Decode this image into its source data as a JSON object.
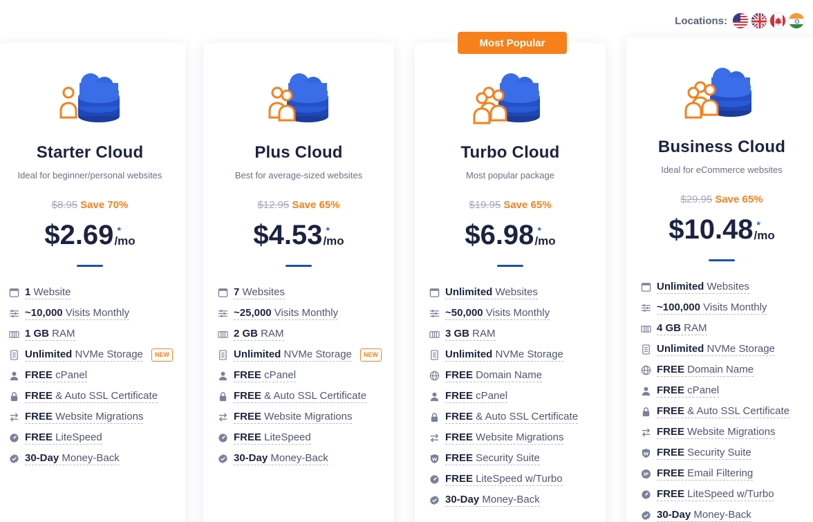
{
  "locations": {
    "label": "Locations:",
    "flags": [
      "us-flag-icon",
      "uk-flag-icon",
      "canada-flag-icon",
      "india-flag-icon"
    ]
  },
  "badge": "Most Popular",
  "colors": {
    "accent": "#f7801b",
    "brand": "#1c4fb8",
    "text": "#1c2340"
  },
  "plans": [
    {
      "name": "Starter Cloud",
      "desc": "Ideal for beginner/personal websites",
      "old_price": "$8.95",
      "save": "Save 70%",
      "price": "$2.69",
      "star": "*",
      "per": "/mo",
      "features": [
        {
          "icon": "window-icon",
          "bold": "1",
          "text": " Website"
        },
        {
          "icon": "sliders-icon",
          "bold": "~10,000",
          "text": " Visits Monthly"
        },
        {
          "icon": "ram-icon",
          "bold": "1 GB",
          "text": " RAM"
        },
        {
          "icon": "storage-icon",
          "bold": "Unlimited",
          "text": " NVMe Storage",
          "tag": "NEW"
        },
        {
          "icon": "user-icon",
          "bold": "FREE",
          "text": " cPanel"
        },
        {
          "icon": "lock-icon",
          "bold": "FREE",
          "text": " & Auto SSL Certificate"
        },
        {
          "icon": "arrows-icon",
          "bold": "FREE",
          "text": " Website Migrations"
        },
        {
          "icon": "speed-icon",
          "bold": "FREE",
          "text": " LiteSpeed"
        },
        {
          "icon": "badge-check-icon",
          "bold": "30-Day",
          "text": " Money-Back"
        }
      ]
    },
    {
      "name": "Plus Cloud",
      "desc": "Best for average-sized websites",
      "old_price": "$12.95",
      "save": "Save 65%",
      "price": "$4.53",
      "star": "*",
      "per": "/mo",
      "features": [
        {
          "icon": "window-icon",
          "bold": "7",
          "text": " Websites"
        },
        {
          "icon": "sliders-icon",
          "bold": "~25,000",
          "text": " Visits Monthly"
        },
        {
          "icon": "ram-icon",
          "bold": "2 GB",
          "text": " RAM"
        },
        {
          "icon": "storage-icon",
          "bold": "Unlimited",
          "text": " NVMe Storage",
          "tag": "NEW"
        },
        {
          "icon": "user-icon",
          "bold": "FREE",
          "text": " cPanel"
        },
        {
          "icon": "lock-icon",
          "bold": "FREE",
          "text": " & Auto SSL Certificate"
        },
        {
          "icon": "arrows-icon",
          "bold": "FREE",
          "text": " Website Migrations"
        },
        {
          "icon": "speed-icon",
          "bold": "FREE",
          "text": " LiteSpeed"
        },
        {
          "icon": "badge-check-icon",
          "bold": "30-Day",
          "text": " Money-Back"
        }
      ]
    },
    {
      "name": "Turbo Cloud",
      "desc": "Most popular package",
      "old_price": "$19.95",
      "save": "Save 65%",
      "price": "$6.98",
      "star": "*",
      "per": "/mo",
      "features": [
        {
          "icon": "window-icon",
          "bold": "Unlimited",
          "text": " Websites"
        },
        {
          "icon": "sliders-icon",
          "bold": "~50,000",
          "text": " Visits Monthly"
        },
        {
          "icon": "ram-icon",
          "bold": "3 GB",
          "text": " RAM"
        },
        {
          "icon": "storage-icon",
          "bold": "Unlimited",
          "text": " NVMe Storage"
        },
        {
          "icon": "globe-icon",
          "bold": "FREE",
          "text": " Domain Name"
        },
        {
          "icon": "user-icon",
          "bold": "FREE",
          "text": " cPanel"
        },
        {
          "icon": "lock-icon",
          "bold": "FREE",
          "text": " & Auto SSL Certificate"
        },
        {
          "icon": "arrows-icon",
          "bold": "FREE",
          "text": " Website Migrations"
        },
        {
          "icon": "shield-icon",
          "bold": "FREE",
          "text": " Security Suite"
        },
        {
          "icon": "speed-icon",
          "bold": "FREE",
          "text": " LiteSpeed w/Turbo"
        },
        {
          "icon": "badge-check-icon",
          "bold": "30-Day",
          "text": " Money-Back"
        }
      ]
    },
    {
      "name": "Business Cloud",
      "desc": "Ideal for eCommerce websites",
      "old_price": "$29.95",
      "save": "Save 65%",
      "price": "$10.48",
      "star": "*",
      "per": "/mo",
      "features": [
        {
          "icon": "window-icon",
          "bold": "Unlimited",
          "text": " Websites"
        },
        {
          "icon": "sliders-icon",
          "bold": "~100,000",
          "text": " Visits Monthly"
        },
        {
          "icon": "ram-icon",
          "bold": "4 GB",
          "text": " RAM"
        },
        {
          "icon": "storage-icon",
          "bold": "Unlimited",
          "text": " NVMe Storage"
        },
        {
          "icon": "globe-icon",
          "bold": "FREE",
          "text": " Domain Name"
        },
        {
          "icon": "user-icon",
          "bold": "FREE",
          "text": " cPanel"
        },
        {
          "icon": "lock-icon",
          "bold": "FREE",
          "text": " & Auto SSL Certificate"
        },
        {
          "icon": "arrows-icon",
          "bold": "FREE",
          "text": " Website Migrations"
        },
        {
          "icon": "shield-icon",
          "bold": "FREE",
          "text": " Security Suite"
        },
        {
          "icon": "ip-icon",
          "bold": "FREE",
          "text": " Email Filtering"
        },
        {
          "icon": "speed-icon",
          "bold": "FREE",
          "text": " LiteSpeed w/Turbo"
        },
        {
          "icon": "badge-check-icon",
          "bold": "30-Day",
          "text": " Money-Back"
        }
      ]
    }
  ]
}
